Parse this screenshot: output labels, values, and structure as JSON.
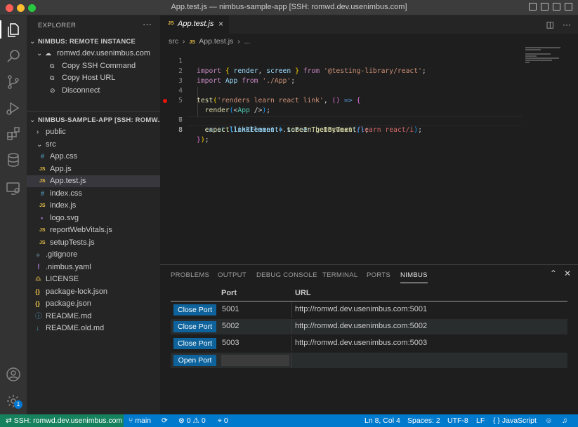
{
  "window": {
    "title": "App.test.js — nimbus-sample-app [SSH: romwd.dev.usenimbus.com]"
  },
  "activity": {
    "settings_badge": "1"
  },
  "sidebar": {
    "title": "EXPLORER",
    "more": "···",
    "remote_section": {
      "title": "NIMBUS: REMOTE INSTANCE",
      "host": "romwd.dev.usenimbus.com",
      "actions": [
        "Copy SSH Command",
        "Copy Host URL",
        "Disconnect"
      ]
    },
    "project_section": {
      "title": "NIMBUS-SAMPLE-APP [SSH: ROMW...",
      "items": [
        {
          "label": "public",
          "type": "folder",
          "icon": "›"
        },
        {
          "label": "src",
          "type": "folder-open",
          "icon": "⌄"
        },
        {
          "label": "App.css",
          "type": "css",
          "icon": "#"
        },
        {
          "label": "App.js",
          "type": "js",
          "icon": "JS"
        },
        {
          "label": "App.test.js",
          "type": "js",
          "icon": "JS"
        },
        {
          "label": "index.css",
          "type": "css",
          "icon": "#"
        },
        {
          "label": "index.js",
          "type": "js",
          "icon": "JS"
        },
        {
          "label": "logo.svg",
          "type": "svg",
          "icon": "▪"
        },
        {
          "label": "reportWebVitals.js",
          "type": "js",
          "icon": "JS"
        },
        {
          "label": "setupTests.js",
          "type": "js",
          "icon": "JS"
        },
        {
          "label": ".gitignore",
          "type": "git",
          "icon": "◆"
        },
        {
          "label": ".nimbus.yaml",
          "type": "yaml",
          "icon": "!"
        },
        {
          "label": "LICENSE",
          "type": "license",
          "icon": "♎"
        },
        {
          "label": "package-lock.json",
          "type": "json",
          "icon": "{}"
        },
        {
          "label": "package.json",
          "type": "json",
          "icon": "{}"
        },
        {
          "label": "README.md",
          "type": "info",
          "icon": "ⓘ"
        },
        {
          "label": "README.old.md",
          "type": "md",
          "icon": "↓"
        }
      ]
    }
  },
  "editor": {
    "tab": {
      "label": "App.test.js",
      "badge": "JS",
      "close": "×"
    },
    "breadcrumbs": [
      "src",
      "App.test.js",
      "..."
    ],
    "lines": [
      {
        "n": "1",
        "text": "import { render, screen } from '@testing-library/react';"
      },
      {
        "n": "2",
        "text": "import App from './App';"
      },
      {
        "n": "3",
        "text": ""
      },
      {
        "n": "4",
        "text": "test('renders learn react link', () => {"
      },
      {
        "n": "5",
        "text": "  render(<App />);"
      },
      {
        "n": "6",
        "text": "  const linkElement = screen.getByText(/learn react/i);"
      },
      {
        "n": "7",
        "text": "  expect(linkElement).toBeInTheDocument();"
      },
      {
        "n": "8",
        "text": "});"
      }
    ]
  },
  "panel": {
    "tabs": [
      "PROBLEMS",
      "OUTPUT",
      "DEBUG CONSOLE",
      "TERMINAL",
      "PORTS",
      "NIMBUS"
    ],
    "active_tab": "NIMBUS",
    "table": {
      "headers": [
        "Port",
        "URL"
      ],
      "rows": [
        {
          "button": "Close Port",
          "port": "5001",
          "url": "http://romwd.dev.usenimbus.com:5001"
        },
        {
          "button": "Close Port",
          "port": "5002",
          "url": "http://romwd.dev.usenimbus.com:5002"
        },
        {
          "button": "Close Port",
          "port": "5003",
          "url": "http://romwd.dev.usenimbus.com:5003"
        }
      ],
      "open_button": "Open Port",
      "open_input_value": ""
    }
  },
  "status": {
    "remote": "SSH: romwd.dev.usenimbus.com",
    "branch": "main",
    "errors": "0",
    "warnings": "0",
    "ports": "0",
    "position": "Ln 8, Col 4",
    "spaces": "Spaces: 2",
    "encoding": "UTF-8",
    "eol": "LF",
    "language": "JavaScript"
  },
  "colors": {
    "status_bar": "#007acc",
    "remote_indicator": "#16825d",
    "button": "#0e639c",
    "breakpoint": "#e51400"
  }
}
